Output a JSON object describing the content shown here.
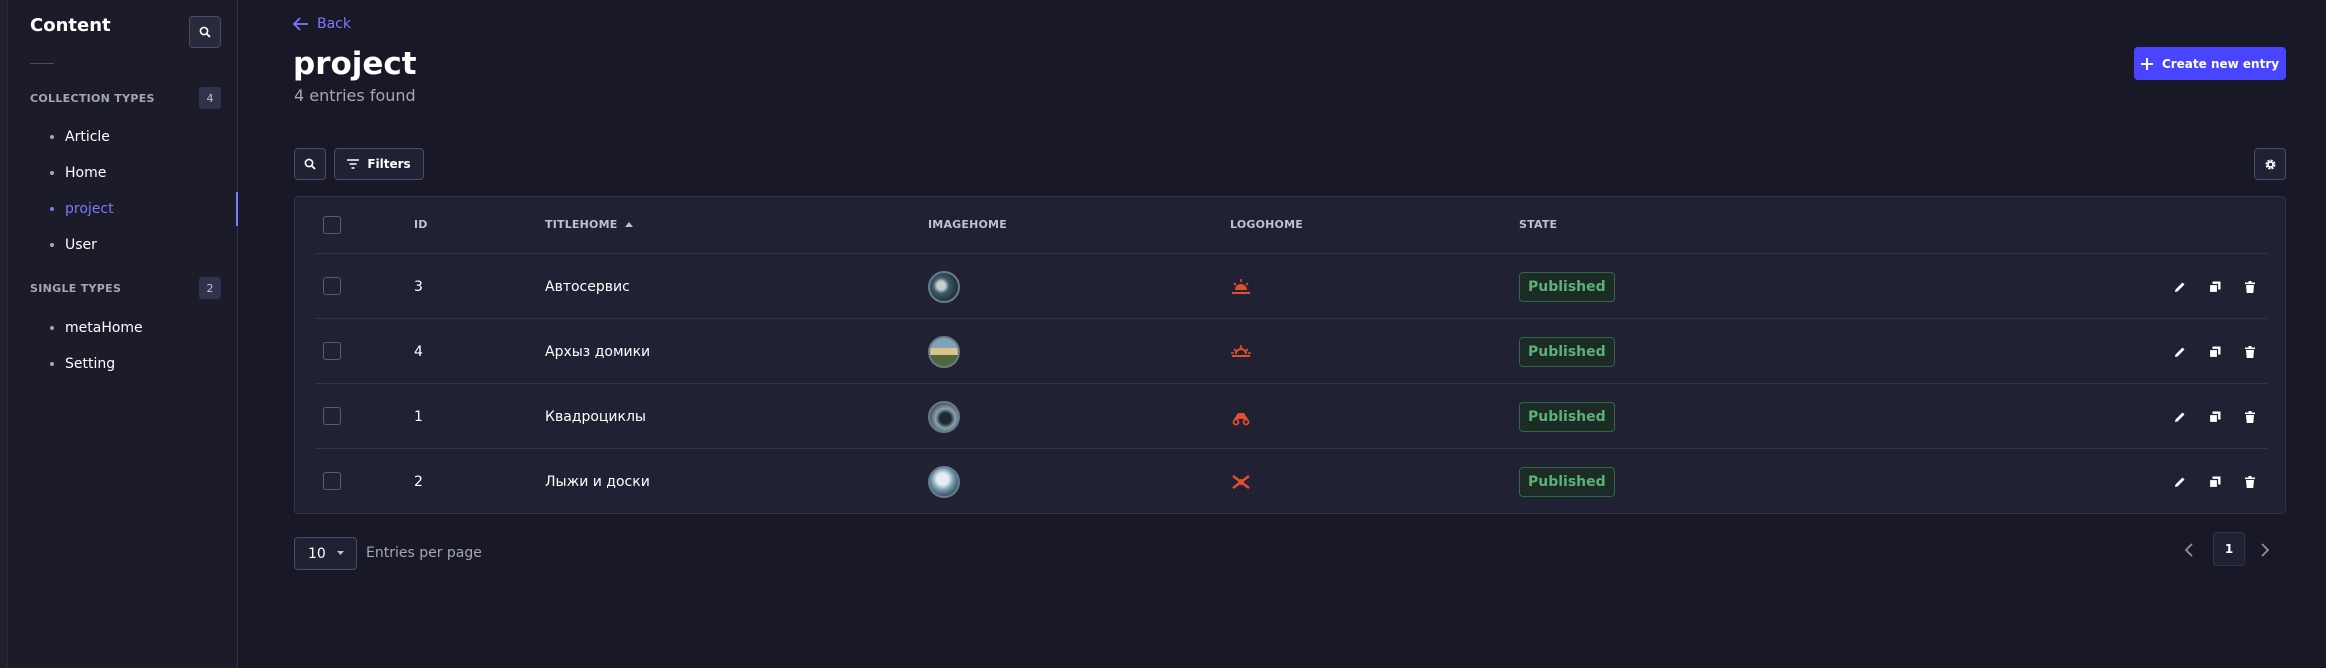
{
  "sidebar": {
    "title": "Content",
    "collection_types": {
      "label": "COLLECTION TYPES",
      "count": "4"
    },
    "single_types": {
      "label": "SINGLE TYPES",
      "count": "2"
    },
    "collection_items": [
      {
        "label": "Article"
      },
      {
        "label": "Home"
      },
      {
        "label": "project"
      },
      {
        "label": "User"
      }
    ],
    "single_items": [
      {
        "label": "metaHome"
      },
      {
        "label": "Setting"
      }
    ]
  },
  "header": {
    "back_label": "Back",
    "title": "project",
    "subtitle": "4 entries found",
    "create_label": "Create new entry"
  },
  "toolbar": {
    "filters_label": "Filters"
  },
  "table": {
    "columns": {
      "id": "ID",
      "title": "TITLEHOME",
      "image": "IMAGEHOME",
      "logo": "LOGOHOME",
      "state": "STATE"
    },
    "rows": [
      {
        "id": "3",
        "title": "Автосервис",
        "state": "Published"
      },
      {
        "id": "4",
        "title": "Архыз домики",
        "state": "Published"
      },
      {
        "id": "1",
        "title": "Квадроциклы",
        "state": "Published"
      },
      {
        "id": "2",
        "title": "Лыжи и доски",
        "state": "Published"
      }
    ]
  },
  "footer": {
    "per_page_value": "10",
    "per_page_label": "Entries per page",
    "current_page": "1"
  },
  "colors": {
    "accent": "#4945ff",
    "link": "#7b79ff",
    "success": "#5cb176",
    "logo": "#e0502d"
  }
}
